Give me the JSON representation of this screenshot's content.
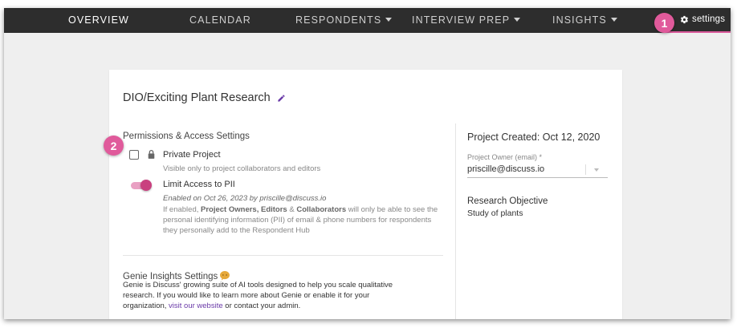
{
  "nav": {
    "items": [
      {
        "label": "OVERVIEW",
        "active": true,
        "dropdown": false
      },
      {
        "label": "CALENDAR",
        "active": false,
        "dropdown": false
      },
      {
        "label": "RESPONDENTS",
        "active": false,
        "dropdown": true
      },
      {
        "label": "INTERVIEW PREP",
        "active": false,
        "dropdown": true
      },
      {
        "label": "INSIGHTS",
        "active": false,
        "dropdown": true
      }
    ],
    "settings_label": "settings",
    "settings_icon": "gear-icon"
  },
  "callouts": [
    "1",
    "2"
  ],
  "project": {
    "title": "DIO/Exciting Plant Research",
    "edit_icon": "pencil-icon"
  },
  "permissions": {
    "heading": "Permissions & Access Settings",
    "private_project": {
      "label": "Private Project",
      "description": "Visible only to project collaborators and editors",
      "checked": false,
      "icon": "lock-icon"
    },
    "limit_pii": {
      "label": "Limit Access to PII",
      "enabled_note": "Enabled on Oct 26, 2023 by priscille@discuss.io",
      "on": true,
      "desc_1": "If enabled, ",
      "desc_owners": "Project Owners, Editors",
      "desc_amp": " & ",
      "desc_collab": "Collaborators",
      "desc_2": " will only be able to see the",
      "desc_line2": "personal identifying information (PII) of email & phone numbers for respondents",
      "desc_line3": "they personally add to the Respondent Hub"
    }
  },
  "genie": {
    "heading": "Genie Insights Settings",
    "icon": "genie-icon",
    "text_1": "Genie is Discuss' growing suite of AI tools designed to help you scale qualitative",
    "text_2": "research. If you would like to learn more about Genie or enable it for your",
    "text_3": "organization, ",
    "link": "visit our website",
    "text_4": " or contact your admin."
  },
  "details": {
    "created": "Project Created: Oct 12, 2020",
    "owner_label": "Project Owner (email) *",
    "owner_value": "priscille@discuss.io",
    "objective_heading": "Research Objective",
    "objective_text": "Study of plants"
  },
  "colors": {
    "nav_bg": "#2d2d2d",
    "accent_pink": "#e05a9b",
    "toggle_on": "#c9407f",
    "link": "#6a3aa8",
    "genie_yellow": "#e6a93a"
  }
}
